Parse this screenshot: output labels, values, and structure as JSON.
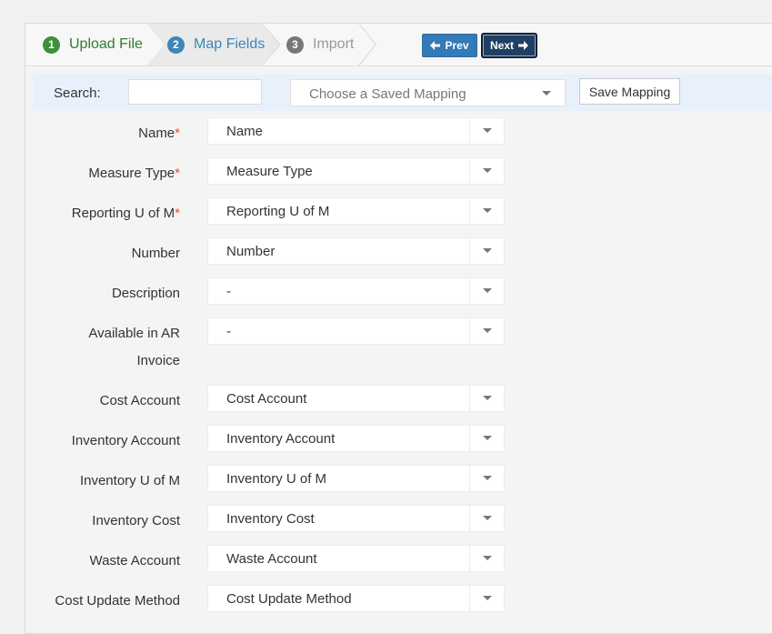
{
  "wizard": {
    "steps": [
      {
        "num": "1",
        "label": "Upload File"
      },
      {
        "num": "2",
        "label": "Map Fields"
      },
      {
        "num": "3",
        "label": "Import"
      }
    ],
    "prev_label": "Prev",
    "next_label": "Next"
  },
  "search": {
    "label": "Search:",
    "value": "",
    "placeholder": "",
    "mapping_placeholder": "Choose a Saved Mapping",
    "save_label": "Save Mapping"
  },
  "fields": [
    {
      "label": "Name",
      "required": "*",
      "value": "Name"
    },
    {
      "label": "Measure Type",
      "required": "*",
      "value": "Measure Type"
    },
    {
      "label": "Reporting U of M",
      "required": "*",
      "value": "Reporting U of M"
    },
    {
      "label": "Number",
      "required": "",
      "value": "Number"
    },
    {
      "label": "Description",
      "required": "",
      "value": "-"
    },
    {
      "label": "Available in AR",
      "label2": "Invoice",
      "required": "",
      "value": "-"
    },
    {
      "label": "Cost Account",
      "required": "",
      "value": "Cost Account"
    },
    {
      "label": "Inventory Account",
      "required": "",
      "value": "Inventory Account"
    },
    {
      "label": "Inventory U of M",
      "required": "",
      "value": "Inventory U of M"
    },
    {
      "label": "Inventory Cost",
      "required": "",
      "value": "Inventory Cost"
    },
    {
      "label": "Waste Account",
      "required": "",
      "value": "Waste Account"
    },
    {
      "label": "Cost Update Method",
      "required": "",
      "value": "Cost Update Method"
    }
  ],
  "icons": {
    "prev": "arrow-left-icon",
    "next": "arrow-right-icon",
    "dropdown": "caret-down-icon"
  },
  "colors": {
    "step_done": "#3f8f3a",
    "step_active": "#3d86b6",
    "step_pending": "#777777",
    "primary": "#337ab7",
    "required": "#d9534f"
  }
}
